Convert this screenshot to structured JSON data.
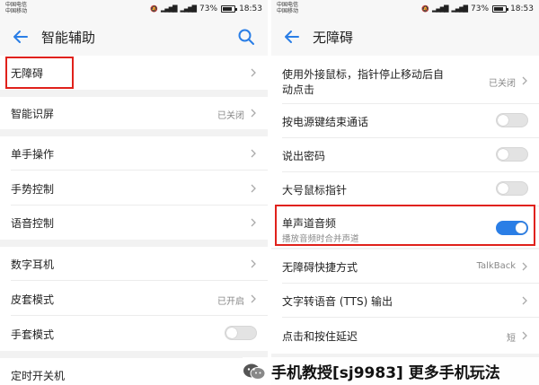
{
  "left": {
    "status": {
      "carrier1": "中国电信",
      "carrier2": "中国移动",
      "battery": "73%",
      "time": "18:53"
    },
    "title": "智能辅助",
    "rows": [
      {
        "label": "无障碍"
      },
      {
        "label": "智能识屏",
        "value": "已关闭"
      },
      {
        "label": "单手操作"
      },
      {
        "label": "手势控制"
      },
      {
        "label": "语音控制"
      },
      {
        "label": "数字耳机"
      },
      {
        "label": "皮套模式",
        "value": "已开启"
      },
      {
        "label": "手套模式",
        "toggle": "off"
      },
      {
        "label": "定时开关机"
      }
    ]
  },
  "right": {
    "status": {
      "carrier1": "中国电信",
      "carrier2": "中国移动",
      "battery": "73%",
      "time": "18:53"
    },
    "title": "无障碍",
    "rows": [
      {
        "label_line1": "使用外接鼠标，指针停止移动后自",
        "label_line2": "动点击",
        "value": "已关闭"
      },
      {
        "label": "按电源键结束通话",
        "toggle": "off"
      },
      {
        "label": "说出密码",
        "toggle": "off"
      },
      {
        "label": "大号鼠标指针",
        "toggle": "off"
      },
      {
        "label": "单声道音频",
        "sub": "播放音频时合并声道",
        "toggle": "on"
      },
      {
        "label": "无障碍快捷方式",
        "value": "TalkBack"
      },
      {
        "label": "文字转语音 (TTS) 输出"
      },
      {
        "label": "点击和按住延迟",
        "value": "短"
      }
    ]
  },
  "watermark": {
    "text": "手机教授[sj9983] 更多手机玩法"
  },
  "colors": {
    "accent": "#2a7ee6",
    "highlight": "#e0211b"
  }
}
